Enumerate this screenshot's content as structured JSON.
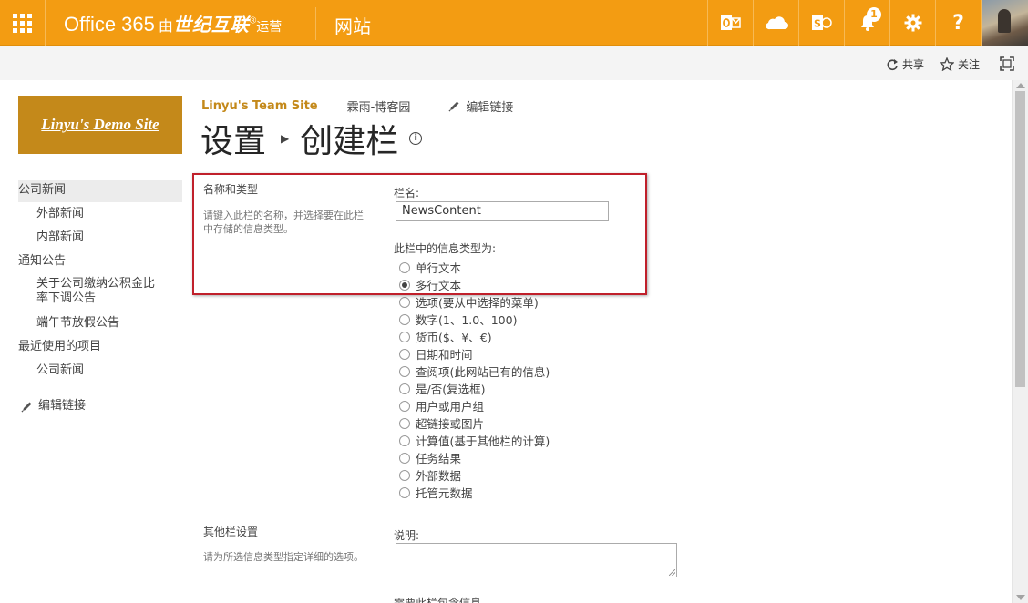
{
  "suitebar": {
    "brand_main": "Office 365",
    "brand_by": "由",
    "brand_partner": "世纪互联",
    "brand_reg": "®",
    "brand_operator": "运营",
    "site_label": "网站",
    "notification_count": "1",
    "help_label": "?"
  },
  "actions": {
    "share": "共享",
    "follow": "关注"
  },
  "site": {
    "logo_text": "Linyu's Demo Site",
    "team_site": "Linyu's Team Site",
    "blog_link": "霖雨-博客园",
    "edit_links": "编辑链接"
  },
  "page": {
    "title_part1": "设置",
    "title_part2": "创建栏",
    "info_icon_label": "i"
  },
  "leftnav": {
    "items": [
      {
        "label": "公司新闻"
      },
      {
        "label": "外部新闻"
      },
      {
        "label": "内部新闻"
      },
      {
        "label": "通知公告"
      },
      {
        "label": "关于公司缴纳公积金比"
      },
      {
        "label": "率下调公告"
      },
      {
        "label": "端午节放假公告"
      },
      {
        "label": "最近使用的项目"
      },
      {
        "label": "公司新闻"
      }
    ],
    "edit_links": "编辑链接"
  },
  "form": {
    "section1": {
      "title": "名称和类型",
      "desc_line1": "请键入此栏的名称，并选择要在此栏",
      "desc_line2": "中存储的信息类型。"
    },
    "column_name_label": "栏名:",
    "column_name_value": "NewsContent",
    "type_label": "此栏中的信息类型为:",
    "types": [
      {
        "label": "单行文本",
        "checked": false
      },
      {
        "label": "多行文本",
        "checked": true
      },
      {
        "label": "选项(要从中选择的菜单)",
        "checked": false
      },
      {
        "label": "数字(1、1.0、100)",
        "checked": false
      },
      {
        "label": "货币($、¥、€)",
        "checked": false
      },
      {
        "label": "日期和时间",
        "checked": false
      },
      {
        "label": "查阅项(此网站已有的信息)",
        "checked": false
      },
      {
        "label": "是/否(复选框)",
        "checked": false
      },
      {
        "label": "用户或用户组",
        "checked": false
      },
      {
        "label": "超链接或图片",
        "checked": false
      },
      {
        "label": "计算值(基于其他栏的计算)",
        "checked": false
      },
      {
        "label": "任务结果",
        "checked": false
      },
      {
        "label": "外部数据",
        "checked": false
      },
      {
        "label": "托管元数据",
        "checked": false
      }
    ],
    "section2": {
      "title": "其他栏设置",
      "desc": "请为所选信息类型指定详细的选项。"
    },
    "description_label": "说明:",
    "required_label": "需要此栏包含信息"
  },
  "colors": {
    "suitebar": "#f39c12",
    "logo_bg": "#c4891a",
    "highlight_box": "#c0202b"
  }
}
